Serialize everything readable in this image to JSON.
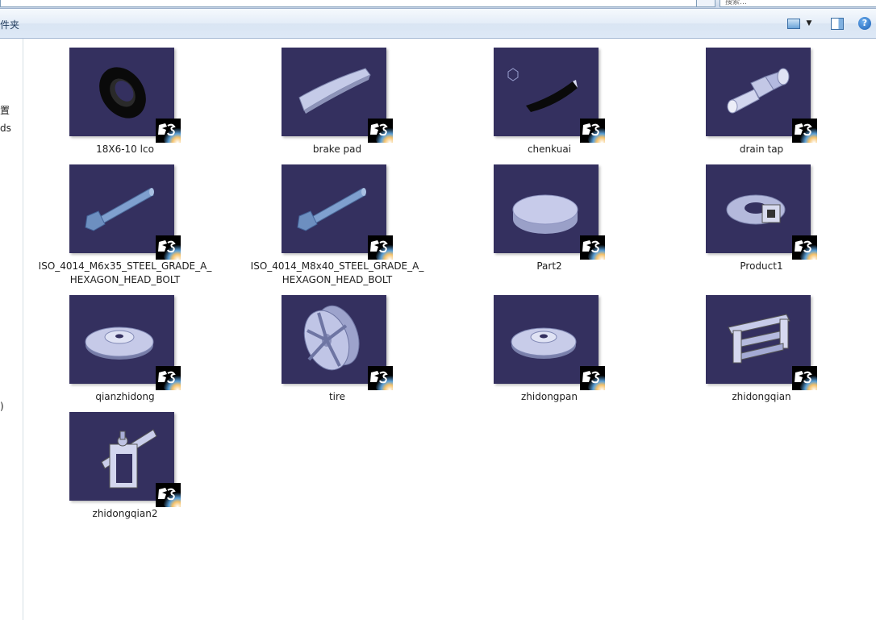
{
  "top": {
    "search_text": "搜索…"
  },
  "command_bar": {
    "folder_label": "件夹",
    "icons": [
      "view-options-icon",
      "dropdown-arrow-icon",
      "preview-pane-icon",
      "help-icon"
    ],
    "help_glyph": "?"
  },
  "nav_pane": {
    "fragments": [
      "置",
      "ds",
      ")"
    ]
  },
  "files": [
    {
      "label": "18X6-10 lco",
      "icon": "tire-ring-model"
    },
    {
      "label": "brake pad",
      "icon": "brake-pad-model"
    },
    {
      "label": "chenkuai",
      "icon": "lining-model"
    },
    {
      "label": "drain tap",
      "icon": "drain-tap-model"
    },
    {
      "label": "ISO_4014_M6x35_STEEL_GRADE_A_\nHEXAGON_HEAD_BOLT",
      "icon": "bolt-model"
    },
    {
      "label": "ISO_4014_M8x40_STEEL_GRADE_A_\nHEXAGON_HEAD_BOLT",
      "icon": "bolt-model"
    },
    {
      "label": "Part2",
      "icon": "disk-model"
    },
    {
      "label": "Product1",
      "icon": "brake-assembly-model"
    },
    {
      "label": "qianzhidong",
      "icon": "brake-disc-model"
    },
    {
      "label": "tire",
      "icon": "wheel-rim-model"
    },
    {
      "label": "zhidongpan",
      "icon": "brake-disc-model"
    },
    {
      "label": "zhidongqian",
      "icon": "caliper-bracket-model"
    },
    {
      "label": "zhidongqian2",
      "icon": "caliper-model"
    }
  ],
  "colors": {
    "thumbnail_bg": "#34305f",
    "part_fill": "#b8bfe6",
    "bolt_fill": "#7fa0cf"
  }
}
